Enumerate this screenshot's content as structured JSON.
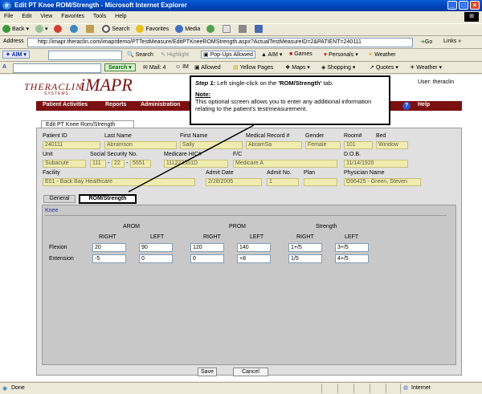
{
  "window": {
    "title": "Edit PT Knee ROM/Strength - Microsoft Internet Explorer",
    "menu": [
      "File",
      "Edit",
      "View",
      "Favorites",
      "Tools",
      "Help"
    ]
  },
  "toolbar": {
    "back": "Back",
    "search": "Search",
    "favorites": "Favorites",
    "media": "Media"
  },
  "address": {
    "label": "Address",
    "url": "http://imapr.theraclin.com/imaprdemo/PTTestMeasure/EditPTKneeROMStrength.aspx?ActualTestMeasureID=2&PATIENT=240111",
    "go": "Go",
    "links": "Links"
  },
  "aimbar": {
    "logo": "AIM",
    "search": "Search",
    "highlight": "Highlight",
    "popups": "Pop-Ups Allowed",
    "aim": "AIM",
    "games": "Games",
    "personals": "Personals",
    "weather": "Weather"
  },
  "searchbar": {
    "search_button": "Search",
    "mail": "Mail: 4",
    "im": "IM",
    "allowed": "Allowed",
    "yellow_pages": "Yellow Pages",
    "maps": "Maps",
    "shopping": "Shopping",
    "quotes": "Quotes",
    "weather": "Weather"
  },
  "app": {
    "logo_thera": "THERACLIN",
    "logo_sub": "SYSTEMS",
    "logo_imapr": "iMAPR",
    "user": "User: theraclin",
    "nav": [
      "Patient Activities",
      "Reports",
      "Administration"
    ],
    "help": "Help",
    "help_badge": "?",
    "form_tab": "Edit PT Knee Rom/Strength"
  },
  "patient": {
    "labels": {
      "patient_id": "Patient ID",
      "last_name": "Last Name",
      "first_name": "First Name",
      "medical_record": "Medical Record #",
      "gender": "Gender",
      "room": "Room#",
      "bed": "Bed",
      "unit": "Unit",
      "ssn": "Social Security No.",
      "medicare": "Medicare HIC#",
      "fc": "F/C",
      "dob": "D.O.B.",
      "facility": "Facility",
      "admit_date": "Admit Date",
      "admit_no": "Admit No.",
      "plan": "Plan",
      "physician": "Physician Name"
    },
    "values": {
      "patient_id": "240111",
      "last_name": "Abramson",
      "first_name": "Sally",
      "medical_record": "AbramSa",
      "gender": "Female",
      "room": "101",
      "bed": "Window",
      "unit": "Subacute",
      "ssn_1": "111",
      "ssn_2": "22",
      "ssn_3": "5551",
      "medicare": "111223551D",
      "fc": "Medicare A",
      "dob": "11/14/1920",
      "facility": "E01 - Back Bay Healthcare",
      "admit_date": "2/28/2005",
      "admit_no": "1",
      "plan": "",
      "physician": "D96425 - Green, Steven"
    }
  },
  "tabs": {
    "general": "General",
    "rom": "ROM/Strength"
  },
  "rom": {
    "section": "Knee",
    "groups": [
      "AROM",
      "PROM",
      "Strength"
    ],
    "sides": [
      "RIGHT",
      "LEFT"
    ],
    "rows": [
      {
        "label": "Flexion",
        "arom_right": "20",
        "arom_left": "90",
        "prom_right": "120",
        "prom_left": "140",
        "str_right": "1+/5",
        "str_left": "3+/5"
      },
      {
        "label": "Extension",
        "arom_right": "-5",
        "arom_left": "0",
        "prom_right": "0",
        "prom_left": "+8",
        "str_right": "1/5",
        "str_left": "4+/5"
      }
    ]
  },
  "buttons": {
    "save": "Save",
    "cancel": "Cancel"
  },
  "callout": {
    "step_prefix": "Step 1:",
    "step_text": " Left single-click on the ",
    "step_target": "'ROM/Strength'",
    "step_suffix": " tab.",
    "note_title": "Note:",
    "note_text": "This optional screen allows you to enter any additional information relating to the patient's test/measurement."
  },
  "status": {
    "text": "Done",
    "zone": "Internet"
  }
}
